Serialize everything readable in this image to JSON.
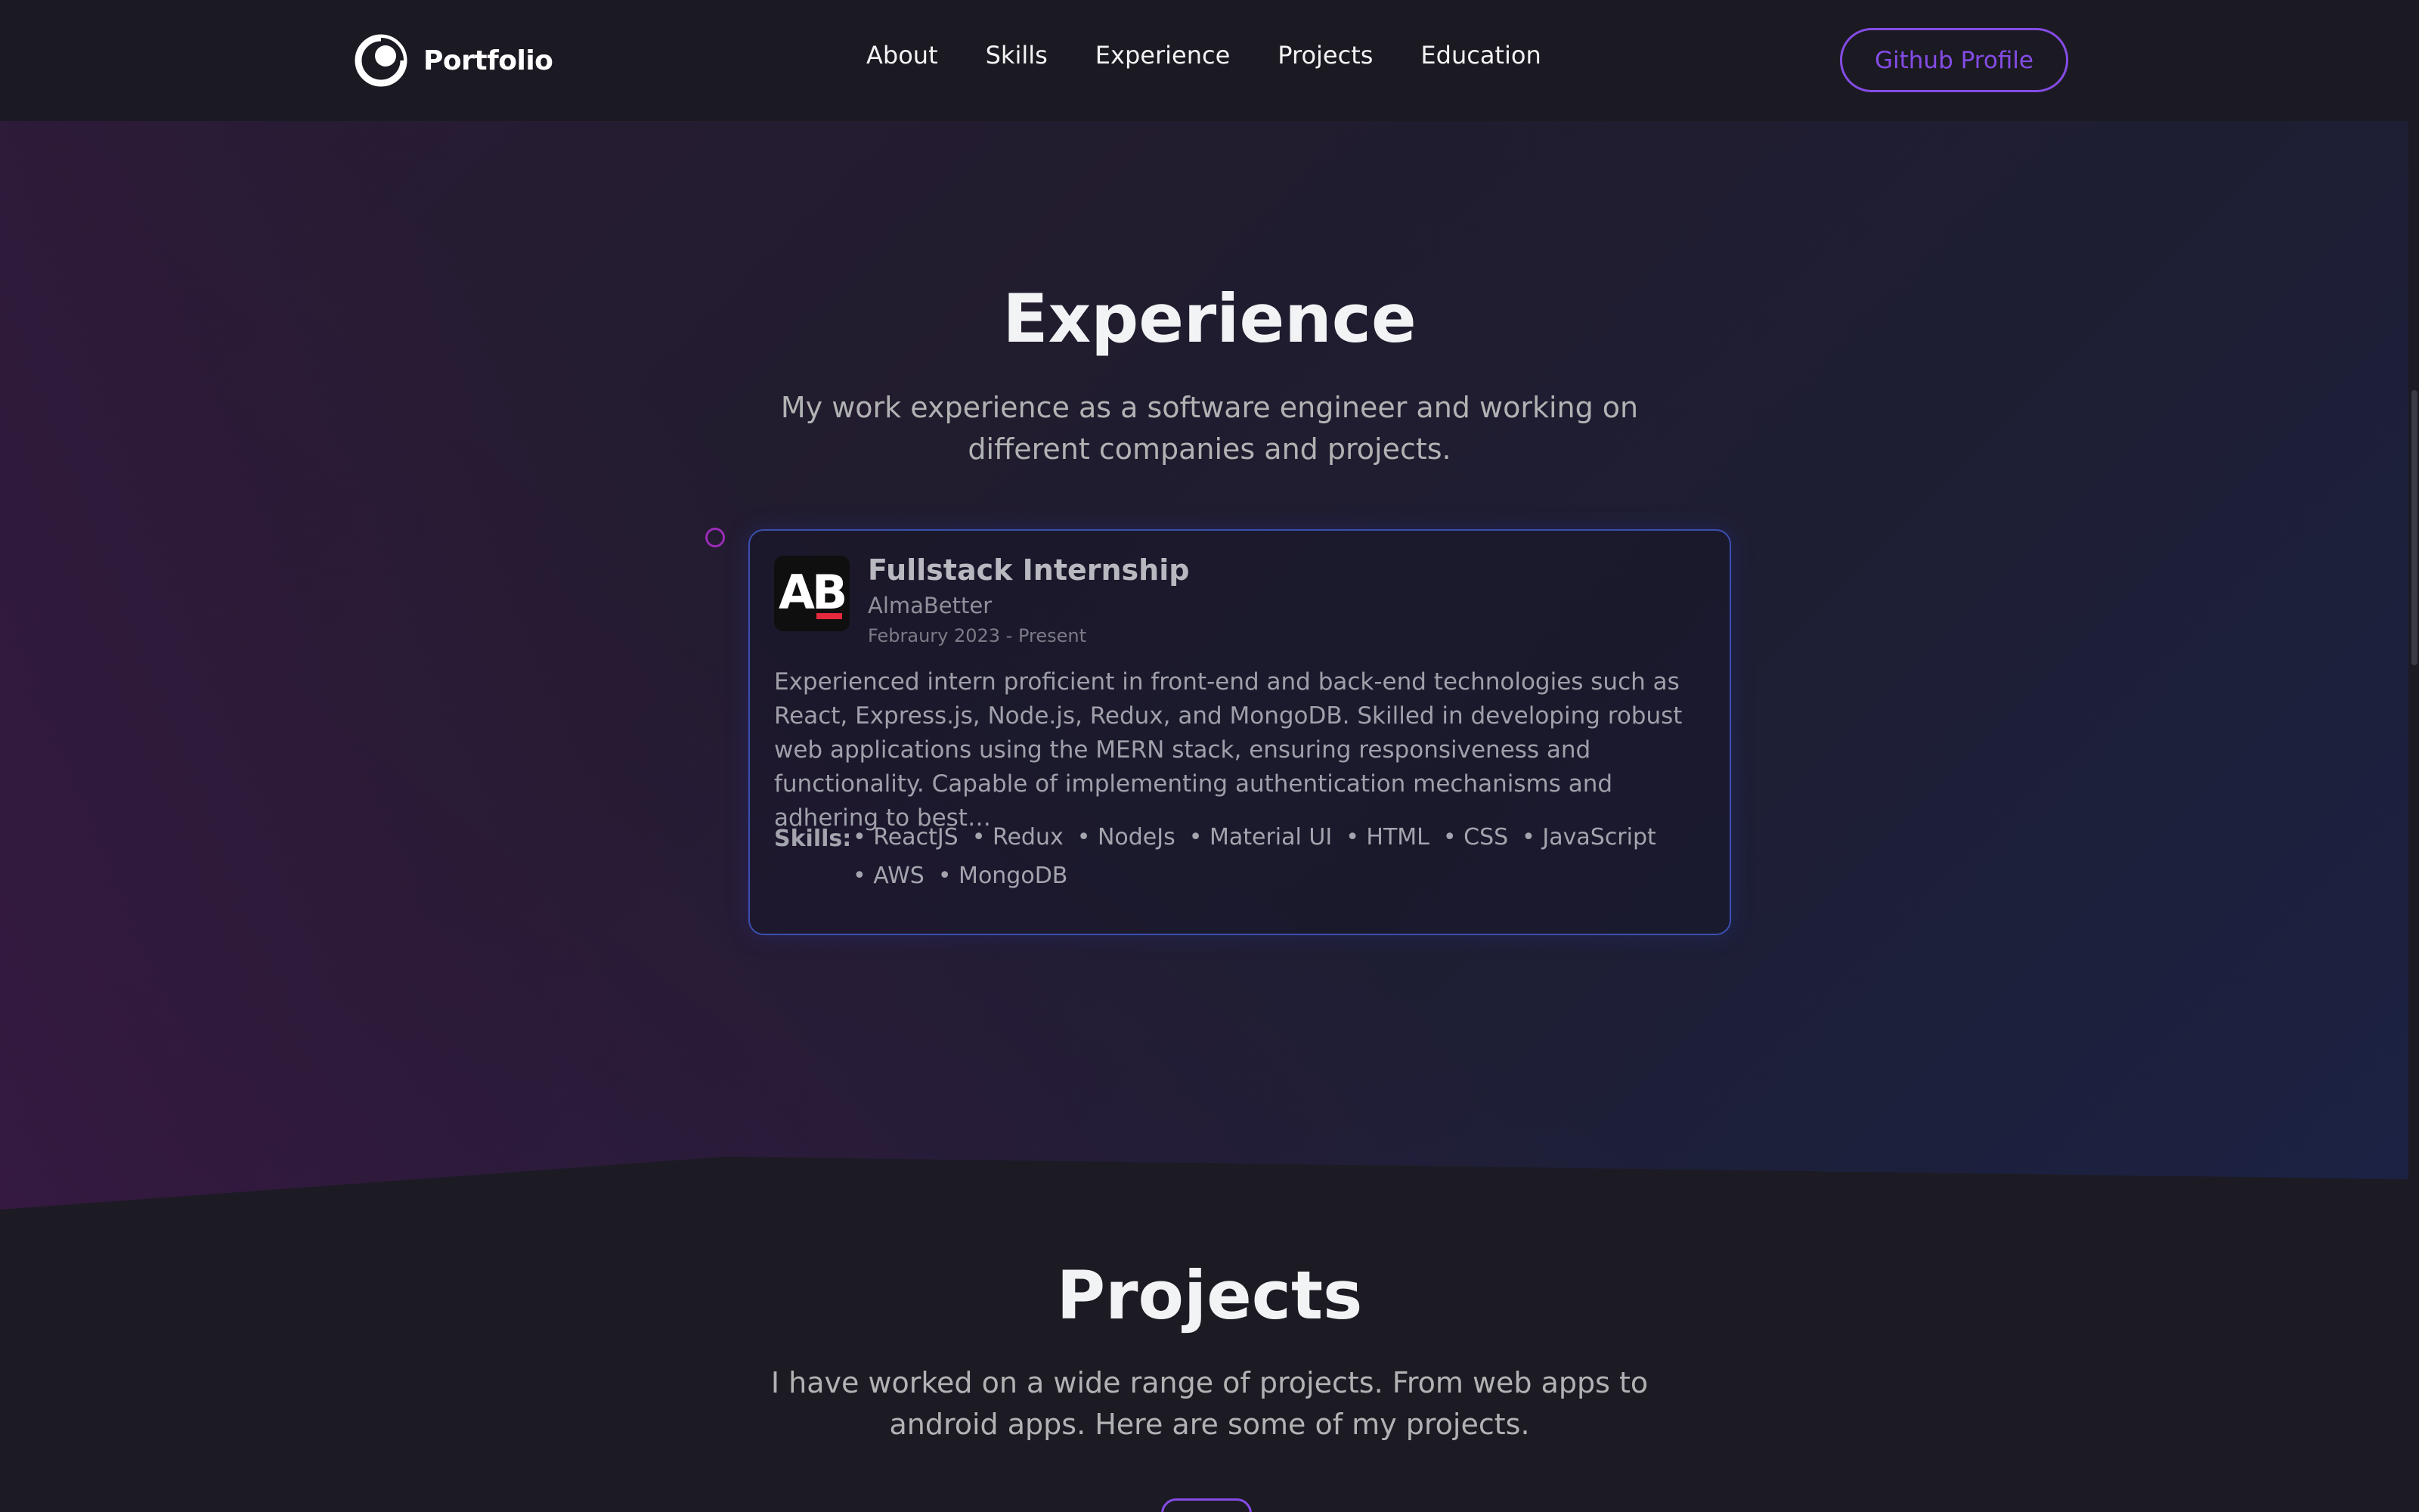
{
  "nav": {
    "logo_text": "Portfolio",
    "links": [
      "About",
      "Skills",
      "Experience",
      "Projects",
      "Education"
    ],
    "github_label": "Github Profile"
  },
  "experience": {
    "title": "Experience",
    "description": "My work experience as a software engineer and working on different companies and projects.",
    "items": [
      {
        "logo_text": "AB",
        "role": "Fullstack Internship",
        "company": "AlmaBetter",
        "date": "Febraury 2023 - Present",
        "description": "Experienced intern proficient in front-end and back-end technologies such as React, Express.js, Node.js, Redux, and MongoDB. Skilled in developing robust web applications using the MERN stack, ensuring responsiveness and functionality. Capable of implementing authentication mechanisms and adhering to best…",
        "skills_label": "Skills:",
        "skills": [
          "• ReactJS",
          "• Redux",
          "• NodeJs",
          "• Material UI",
          "• HTML",
          "• CSS",
          "• JavaScript",
          "• AWS",
          "• MongoDB"
        ]
      }
    ]
  },
  "projects": {
    "title": "Projects",
    "description": "I have worked on a wide range of projects. From web apps to android apps. Here are some of my projects."
  },
  "colors": {
    "accent": "#854ce6",
    "background": "#1c1b24",
    "timeline_dot": "#9b2bb8",
    "card_border": "#3a4fb0"
  }
}
